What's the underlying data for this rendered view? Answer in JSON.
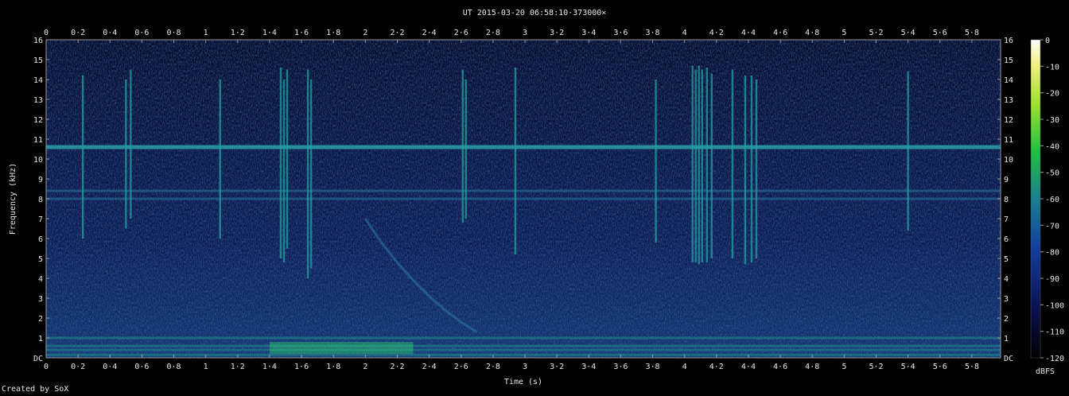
{
  "title": "UT 2015-03-20 06:58:10·373000×",
  "credit": "Created by SoX",
  "colors": {
    "background": "#000000",
    "noise_base": "#0c1a4d",
    "band": "#1e7f8a",
    "bright": "#2ee07a",
    "text": "#e6e6e6"
  },
  "chart_data": {
    "type": "heatmap",
    "title": "UT 2015-03-20 06:58:10·373000×",
    "xlabel": "Time (s)",
    "ylabel": "Frequency (kHz)",
    "xlim": [
      0,
      5.98
    ],
    "ylim": [
      0,
      16
    ],
    "x_ticks": [
      "0",
      "0·2",
      "0·4",
      "0·6",
      "0·8",
      "1",
      "1·2",
      "1·4",
      "1·6",
      "1·8",
      "2",
      "2·2",
      "2·4",
      "2·6",
      "2·8",
      "3",
      "3·2",
      "3·4",
      "3·6",
      "3·8",
      "4",
      "4·2",
      "4·4",
      "4·6",
      "4·8",
      "5",
      "5·2",
      "5·4",
      "5·6",
      "5·8"
    ],
    "y_ticks": [
      "DC",
      "1",
      "2",
      "3",
      "4",
      "5",
      "6",
      "7",
      "8",
      "9",
      "10",
      "11",
      "12",
      "13",
      "14",
      "15",
      "16"
    ],
    "colorbar": {
      "label": "dBFS",
      "ticks": [
        "0",
        "-10",
        "-20",
        "-30",
        "-40",
        "-50",
        "-60",
        "-70",
        "-80",
        "-90",
        "-100",
        "-110",
        "-120"
      ],
      "range": [
        -120,
        0
      ]
    },
    "horizontal_lines_khz": [
      10.6,
      8.4,
      8.0,
      1.0,
      0.6,
      0.4,
      0.15
    ],
    "impulses": [
      {
        "t": 0.23,
        "fmin": 6.0,
        "fmax": 14.2
      },
      {
        "t": 0.5,
        "fmin": 6.5,
        "fmax": 14.0
      },
      {
        "t": 0.53,
        "fmin": 7.0,
        "fmax": 14.5
      },
      {
        "t": 1.09,
        "fmin": 6.0,
        "fmax": 14.0
      },
      {
        "t": 1.47,
        "fmin": 5.0,
        "fmax": 14.6
      },
      {
        "t": 1.49,
        "fmin": 4.8,
        "fmax": 14.0
      },
      {
        "t": 1.51,
        "fmin": 5.5,
        "fmax": 14.5
      },
      {
        "t": 1.64,
        "fmin": 4.0,
        "fmax": 14.5
      },
      {
        "t": 1.66,
        "fmin": 4.5,
        "fmax": 14.0
      },
      {
        "t": 2.61,
        "fmin": 6.8,
        "fmax": 14.5
      },
      {
        "t": 2.63,
        "fmin": 7.0,
        "fmax": 14.0
      },
      {
        "t": 2.94,
        "fmin": 5.2,
        "fmax": 14.6
      },
      {
        "t": 3.82,
        "fmin": 5.8,
        "fmax": 14.0
      },
      {
        "t": 4.05,
        "fmin": 4.8,
        "fmax": 14.7
      },
      {
        "t": 4.07,
        "fmin": 4.8,
        "fmax": 14.5
      },
      {
        "t": 4.09,
        "fmin": 4.7,
        "fmax": 14.7
      },
      {
        "t": 4.11,
        "fmin": 4.8,
        "fmax": 14.5
      },
      {
        "t": 4.14,
        "fmin": 4.8,
        "fmax": 14.6
      },
      {
        "t": 4.17,
        "fmin": 5.0,
        "fmax": 14.3
      },
      {
        "t": 4.3,
        "fmin": 5.0,
        "fmax": 14.5
      },
      {
        "t": 4.38,
        "fmin": 4.7,
        "fmax": 14.2
      },
      {
        "t": 4.42,
        "fmin": 4.8,
        "fmax": 14.2
      },
      {
        "t": 4.45,
        "fmin": 5.0,
        "fmax": 14.0
      },
      {
        "t": 5.4,
        "fmin": 6.4,
        "fmax": 14.4
      }
    ],
    "whistler_curve": [
      {
        "t": 2.0,
        "f": 7.0
      },
      {
        "t": 2.1,
        "f": 5.8
      },
      {
        "t": 2.2,
        "f": 4.8
      },
      {
        "t": 2.3,
        "f": 3.9
      },
      {
        "t": 2.4,
        "f": 3.1
      },
      {
        "t": 2.5,
        "f": 2.4
      },
      {
        "t": 2.6,
        "f": 1.8
      },
      {
        "t": 2.7,
        "f": 1.3
      }
    ]
  }
}
